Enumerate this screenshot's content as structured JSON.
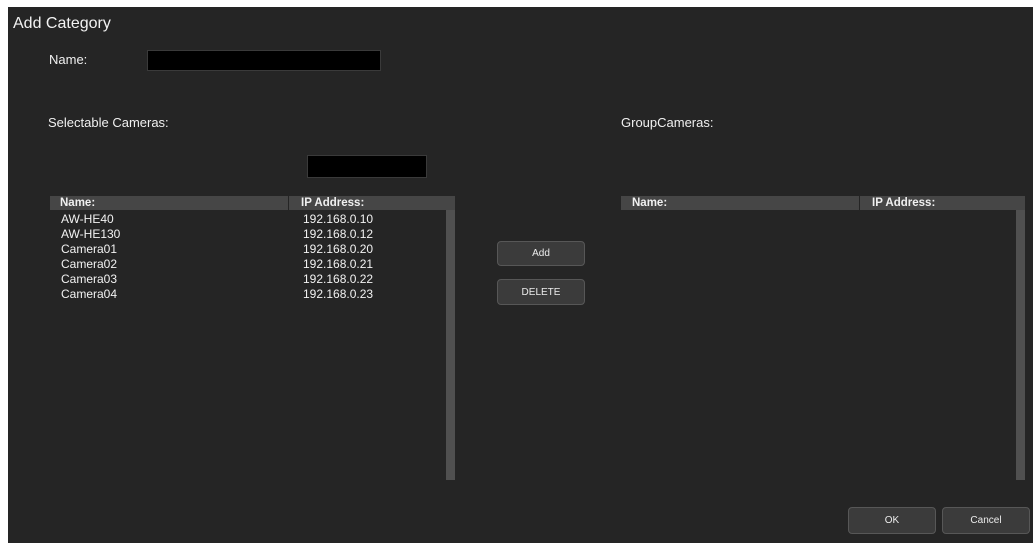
{
  "dialog": {
    "title": "Add Category"
  },
  "name_field": {
    "label": "Name:",
    "value": ""
  },
  "selectable": {
    "label": "Selectable Cameras:",
    "filter_value": "",
    "columns": [
      "Name:",
      "IP Address:"
    ],
    "rows": [
      {
        "name": "AW-HE40",
        "ip": "192.168.0.10"
      },
      {
        "name": "AW-HE130",
        "ip": "192.168.0.12"
      },
      {
        "name": "Camera01",
        "ip": "192.168.0.20"
      },
      {
        "name": "Camera02",
        "ip": "192.168.0.21"
      },
      {
        "name": "Camera03",
        "ip": "192.168.0.22"
      },
      {
        "name": "Camera04",
        "ip": "192.168.0.23"
      }
    ]
  },
  "group": {
    "label": "GroupCameras:",
    "columns": [
      "Name:",
      "IP Address:"
    ],
    "rows": []
  },
  "buttons": {
    "add": "Add",
    "delete": "DELETE",
    "ok": "OK",
    "cancel": "Cancel"
  },
  "colors": {
    "background": "#252525",
    "header": "#464646",
    "scrollbar": "#505050",
    "button": "#3b3b3b",
    "input": "#000000"
  }
}
